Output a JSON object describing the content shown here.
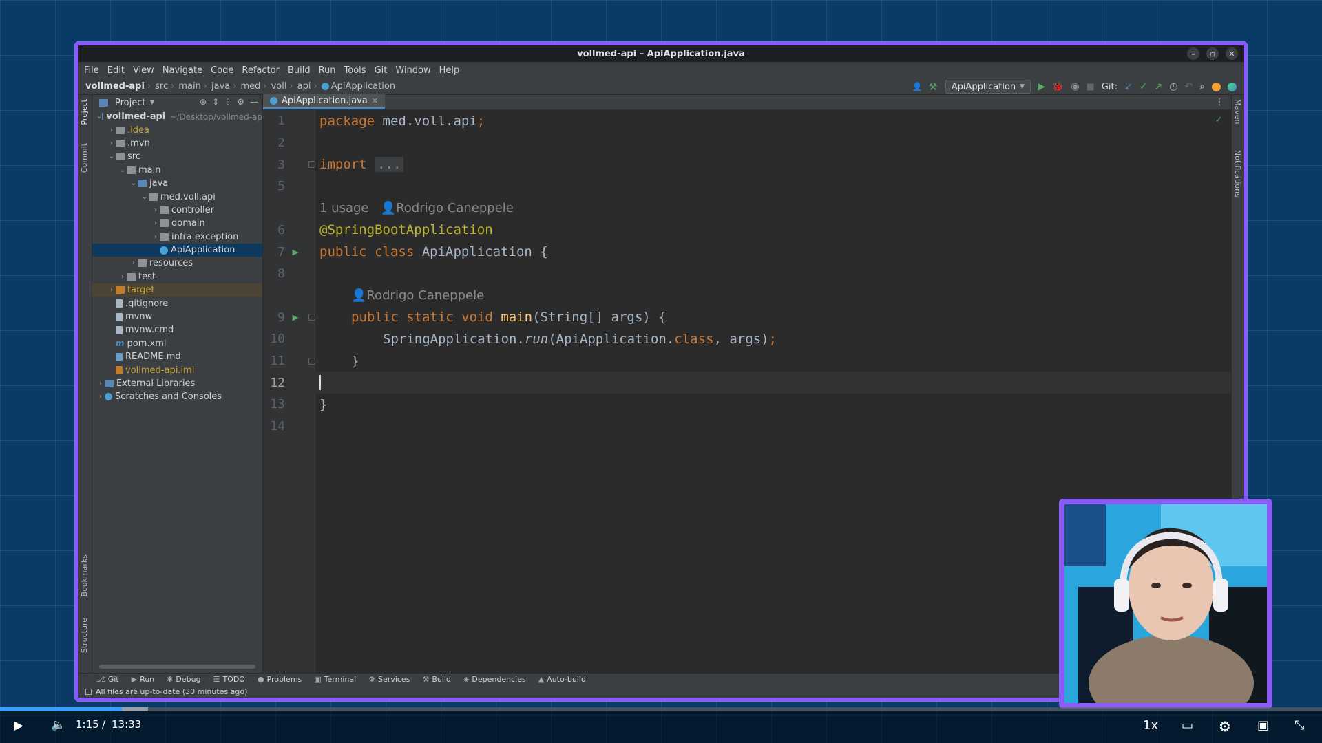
{
  "window": {
    "title": "vollmed-api – ApiApplication.java"
  },
  "menu": [
    "File",
    "Edit",
    "View",
    "Navigate",
    "Code",
    "Refactor",
    "Build",
    "Run",
    "Tools",
    "Git",
    "Window",
    "Help"
  ],
  "breadcrumbs": [
    "vollmed-api",
    "src",
    "main",
    "java",
    "med",
    "voll",
    "api",
    "ApiApplication"
  ],
  "toolbar": {
    "run_config": "ApiApplication",
    "git_label": "Git:"
  },
  "side_labels": {
    "project": "Project",
    "commit": "Commit",
    "bookmarks": "Bookmarks",
    "structure": "Structure",
    "maven": "Maven",
    "notifications": "Notifications"
  },
  "project_panel": {
    "title": "Project",
    "tree": [
      {
        "label": "vollmed-api",
        "note": "~/Desktop/vollmed-ap"
      },
      {
        "label": ".idea"
      },
      {
        "label": ".mvn"
      },
      {
        "label": "src"
      },
      {
        "label": "main"
      },
      {
        "label": "java"
      },
      {
        "label": "med.voll.api"
      },
      {
        "label": "controller"
      },
      {
        "label": "domain"
      },
      {
        "label": "infra.exception"
      },
      {
        "label": "ApiApplication"
      },
      {
        "label": "resources"
      },
      {
        "label": "test"
      },
      {
        "label": "target"
      },
      {
        "label": ".gitignore"
      },
      {
        "label": "mvnw"
      },
      {
        "label": "mvnw.cmd"
      },
      {
        "label": "pom.xml"
      },
      {
        "label": "README.md"
      },
      {
        "label": "vollmed-api.iml"
      },
      {
        "label": "External Libraries"
      },
      {
        "label": "Scratches and Consoles"
      }
    ]
  },
  "editor": {
    "tab": "ApiApplication.java",
    "line_numbers": [
      "1",
      "2",
      "3",
      "5",
      "6",
      "7",
      "8",
      "9",
      "10",
      "11",
      "12",
      "13",
      "14"
    ],
    "code": {
      "l1_kw": "package",
      "l1_rest": " med.voll.api",
      "l1_semi": ";",
      "l3_kw": "import",
      "l3_fold": "...",
      "hint1_usage": "1 usage",
      "hint1_author": "Rodrigo Caneppele",
      "l6_ann": "@SpringBootApplication",
      "l7_kw": "public class",
      "l7_rest": " ApiApplication {",
      "hint2_author": "Rodrigo Caneppele",
      "l9_kw": "public static void",
      "l9_fn": " main",
      "l9_rest": "(String[] args) {",
      "l10_a": "SpringApplication.",
      "l10_run": "run",
      "l10_b": "(ApiApplication.",
      "l10_class": "class",
      "l10_c": ", args)",
      "l10_semi": ";",
      "l11": "}",
      "l13": "}"
    }
  },
  "tool_tabs": [
    "Git",
    "Run",
    "Debug",
    "TODO",
    "Problems",
    "Terminal",
    "Services",
    "Build",
    "Dependencies",
    "Auto-build"
  ],
  "status": {
    "message": "All files are up-to-date (30 minutes ago)"
  },
  "player": {
    "current": "1:15",
    "separator": "/",
    "duration": "13:33",
    "speed": "1x",
    "progress": 0.092
  }
}
